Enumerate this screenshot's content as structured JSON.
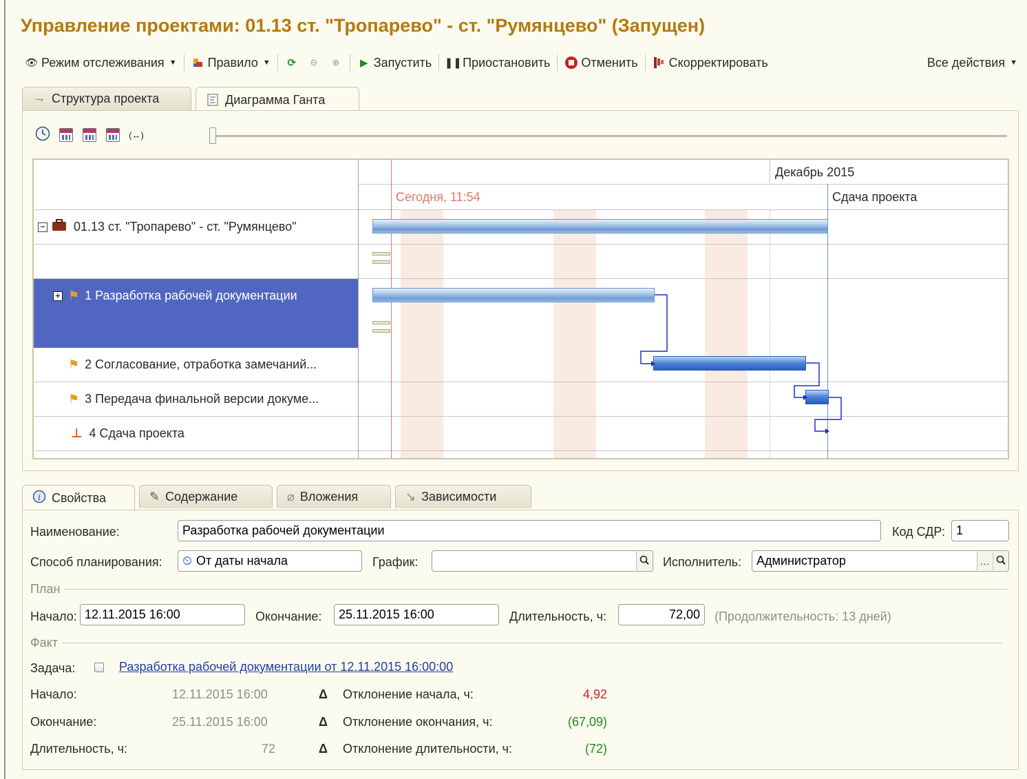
{
  "title": "Управление проектами: 01.13 ст. \"Тропарево\" - ст. \"Румянцево\" (Запущен)",
  "toolbar": {
    "mode": "Режим отслеживания",
    "rule": "Правило",
    "start": "Запустить",
    "pause": "Приостановить",
    "cancel": "Отменить",
    "adjust": "Скорректировать",
    "all_actions": "Все действия"
  },
  "top_tabs": [
    "Структура проекта",
    "Диаграмма Ганта"
  ],
  "gantt": {
    "month": "Декабрь 2015",
    "today": "Сегодня, 11:54",
    "deadline": "Сдача проекта",
    "rows": [
      "01.13 ст. \"Тропарево\" - ст. \"Румянцево\"",
      "1 Разработка рабочей документации",
      "2 Согласование, отработка замечаний...",
      "3 Передача финальной версии докуме...",
      "4 Сдача проекта"
    ]
  },
  "bottom_tabs": [
    "Свойства",
    "Содержание",
    "Вложения",
    "Зависимости"
  ],
  "form": {
    "name_label": "Наименование:",
    "name_value": "Разработка рабочей документации",
    "wbs_label": "Код СДР:",
    "wbs_value": "1",
    "planning_label": "Способ планирования:",
    "planning_value": "От даты начала",
    "schedule_label": "График:",
    "schedule_value": "",
    "executor_label": "Исполнитель:",
    "executor_value": "Администратор",
    "plan_section": "План",
    "plan_start_label": "Начало:",
    "plan_start_value": "12.11.2015 16:00",
    "plan_end_label": "Окончание:",
    "plan_end_value": "25.11.2015 16:00",
    "plan_duration_label": "Длительность, ч:",
    "plan_duration_value": "72,00",
    "plan_duration_note": "(Продолжительность: 13 дней)",
    "fact_section": "Факт",
    "task_label": "Задача:",
    "task_link": "Разработка рабочей документации от 12.11.2015 16:00:00",
    "fact_start_label": "Начало:",
    "fact_start_value": "12.11.2015 16:00",
    "fact_end_label": "Окончание:",
    "fact_end_value": "25.11.2015 16:00",
    "fact_duration_label": "Длительность, ч:",
    "fact_duration_value": "72",
    "dev_start_label": "Отклонение начала, ч:",
    "dev_start_value": "4,92",
    "dev_end_label": "Отклонение окончания, ч:",
    "dev_end_value": "(67,09)",
    "dev_duration_label": "Отклонение длительности, ч:",
    "dev_duration_value": "(72)",
    "delta_symbol": "Δ"
  }
}
